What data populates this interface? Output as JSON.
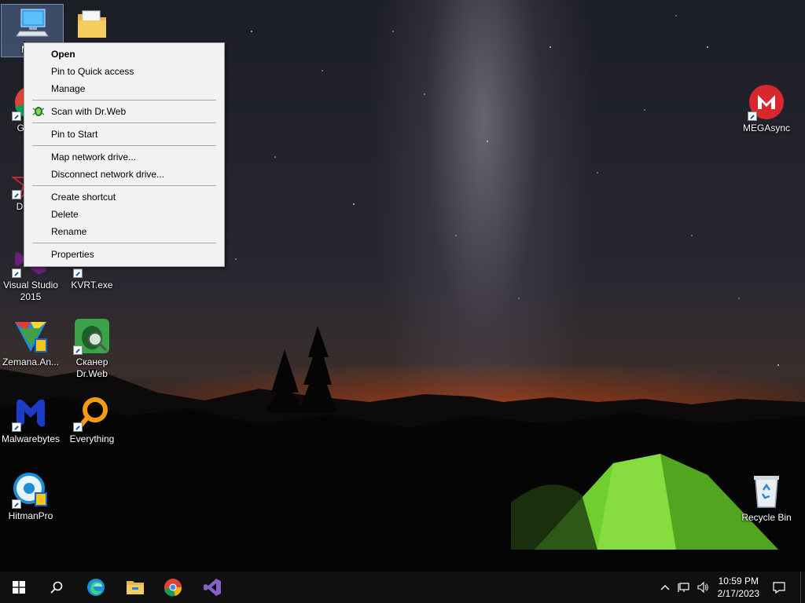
{
  "desktop": {
    "icons": [
      {
        "label": "My C"
      },
      {
        "label": ""
      },
      {
        "label": "Go Ch"
      },
      {
        "label": "DataW"
      },
      {
        "label": "Visual Studio 2015"
      },
      {
        "label": "KVRT.exe"
      },
      {
        "label": "Zemana.An..."
      },
      {
        "label": "Сканер Dr.Web"
      },
      {
        "label": "Malwarebytes"
      },
      {
        "label": "Everything"
      },
      {
        "label": "HitmanPro"
      },
      {
        "label": "MEGAsync"
      },
      {
        "label": "Recycle Bin"
      }
    ]
  },
  "context_menu": {
    "items": [
      {
        "label": "Open"
      },
      {
        "label": "Pin to Quick access"
      },
      {
        "label": "Manage"
      },
      {
        "label": "Scan with Dr.Web"
      },
      {
        "label": "Pin to Start"
      },
      {
        "label": "Map network drive..."
      },
      {
        "label": "Disconnect network drive..."
      },
      {
        "label": "Create shortcut"
      },
      {
        "label": "Delete"
      },
      {
        "label": "Rename"
      },
      {
        "label": "Properties"
      }
    ]
  },
  "taskbar": {
    "apps": [
      "start-icon",
      "search-icon",
      "edge-icon",
      "file-explorer-icon",
      "chrome-icon",
      "visual-studio-icon"
    ],
    "time": "10:59 PM",
    "date": "2/17/2023"
  },
  "colors": {
    "menu_bg": "#f2f2f2",
    "taskbar_bg": "#101010",
    "mega_red": "#d9272e",
    "tent_green": "#7fd63a"
  }
}
